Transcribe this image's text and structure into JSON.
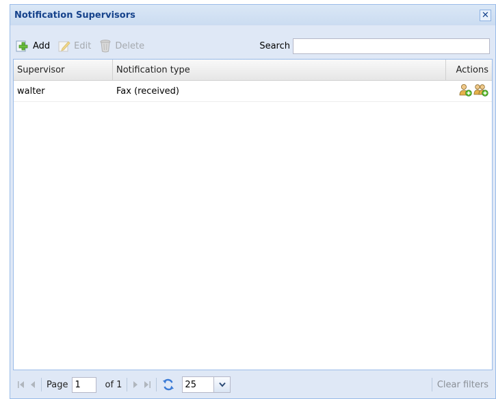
{
  "window": {
    "title": "Notification Supervisors",
    "close_icon": "close-icon"
  },
  "toolbar": {
    "add_label": "Add",
    "edit_label": "Edit",
    "delete_label": "Delete",
    "search_label": "Search",
    "search_value": ""
  },
  "grid": {
    "columns": [
      "Supervisor",
      "Notification type",
      "Actions"
    ],
    "rows": [
      {
        "supervisor": "walter",
        "notification_type": "Fax (received)",
        "actions": [
          "add-user-icon",
          "add-group-icon"
        ]
      }
    ]
  },
  "pager": {
    "page_label": "Page",
    "page_value": "1",
    "of_label": "of 1",
    "page_size": "25",
    "clear_filters_label": "Clear filters"
  }
}
